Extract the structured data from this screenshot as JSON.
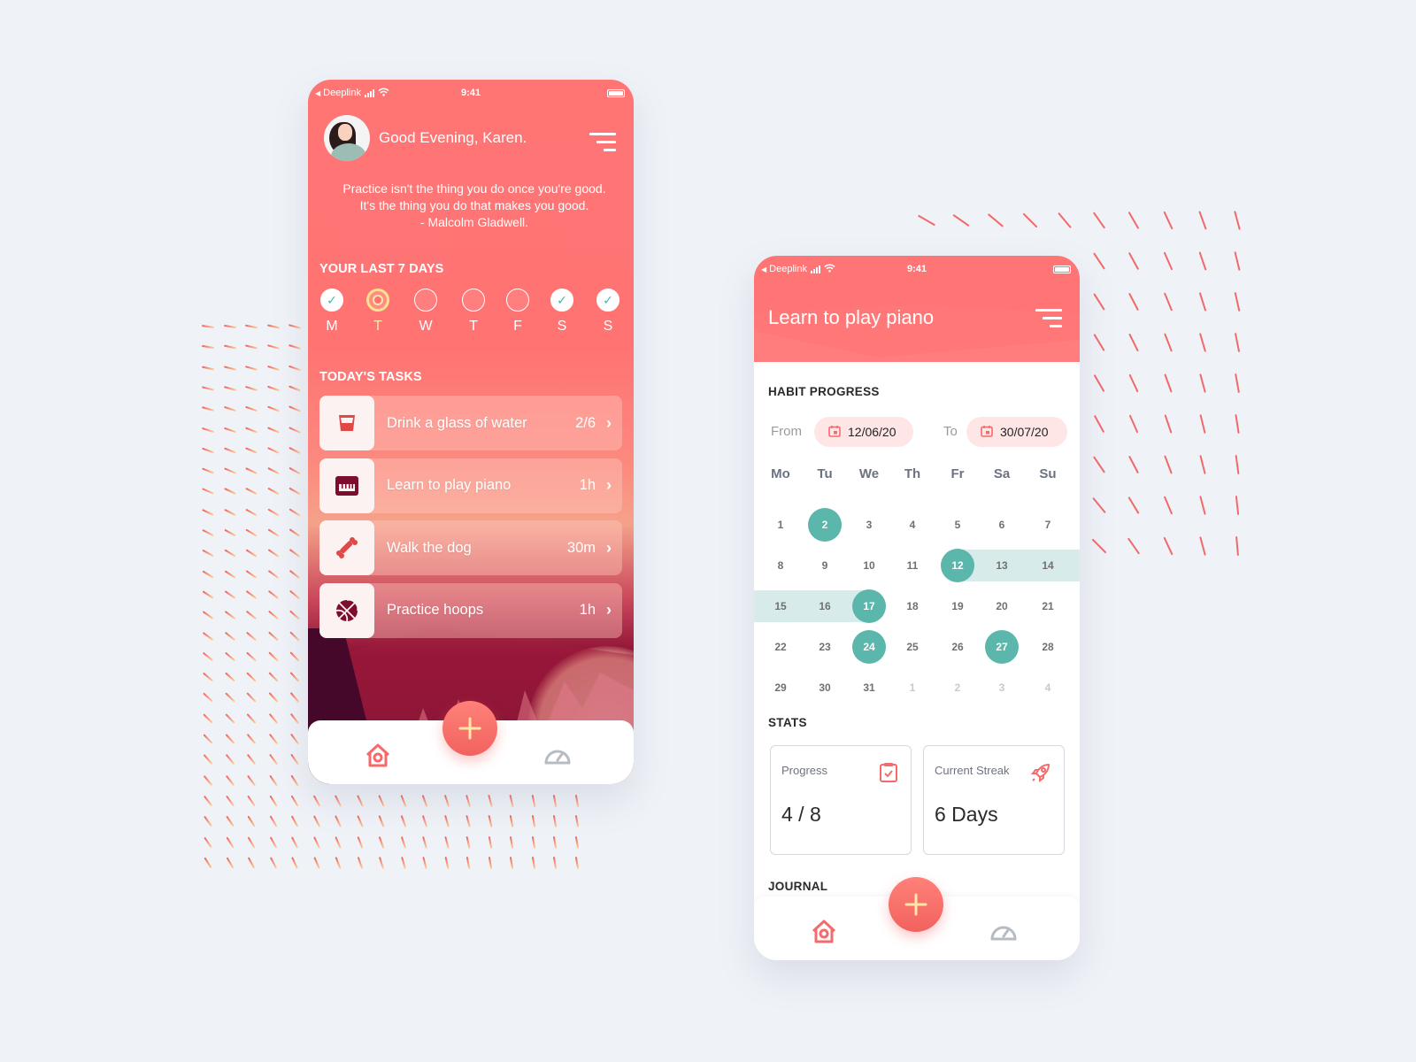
{
  "status_bar": {
    "back_label": "◀",
    "carrier": "Deeplink",
    "wifi_icon": "wifi-icon",
    "time": "9:41"
  },
  "home_screen": {
    "greeting": "Good Evening, Karen.",
    "avatar_icon": "avatar-karen",
    "menu_icon": "menu-icon",
    "quote_line1": "Practice isn't the thing you do once you're good.",
    "quote_line2": "It's the thing you do that makes you good.",
    "quote_line3": "- Malcolm Gladwell.",
    "last7_title": "YOUR LAST 7 DAYS",
    "days": [
      {
        "label": "M",
        "state": "done"
      },
      {
        "label": "T",
        "state": "current"
      },
      {
        "label": "W",
        "state": "empty"
      },
      {
        "label": "T",
        "state": "empty"
      },
      {
        "label": "F",
        "state": "empty"
      },
      {
        "label": "S",
        "state": "done"
      },
      {
        "label": "S",
        "state": "done"
      }
    ],
    "check_glyph": "✓",
    "tasks_title": "TODAY'S TASKS",
    "tasks": [
      {
        "name": "Drink a glass of water",
        "value": "2/6",
        "icon": "glass-icon"
      },
      {
        "name": "Learn to play piano",
        "value": "1h",
        "icon": "piano-icon"
      },
      {
        "name": "Walk the dog",
        "value": "30m",
        "icon": "bone-icon"
      },
      {
        "name": "Practice hoops",
        "value": "1h",
        "icon": "basketball-icon"
      }
    ],
    "chevron": "›"
  },
  "habit_screen": {
    "title": "Learn to play piano",
    "habit_progress_title": "HABIT PROGRESS",
    "from_label": "From",
    "from_date": "12/06/20",
    "to_label": "To",
    "to_date": "30/07/20",
    "weekdays": [
      "Mo",
      "Tu",
      "We",
      "Th",
      "Fr",
      "Sa",
      "Su"
    ],
    "calendar_weeks": [
      [
        "1",
        "2",
        "3",
        "4",
        "5",
        "6",
        "7"
      ],
      [
        "8",
        "9",
        "10",
        "11",
        "12",
        "13",
        "14"
      ],
      [
        "15",
        "16",
        "17",
        "18",
        "19",
        "20",
        "21"
      ],
      [
        "22",
        "23",
        "24",
        "25",
        "26",
        "27",
        "28"
      ],
      [
        "29",
        "30",
        "31",
        "1",
        "2",
        "3",
        "4"
      ]
    ],
    "selected_days": [
      "2",
      "12",
      "17",
      "24",
      "27"
    ],
    "streak_range": {
      "start": "12",
      "end": "17"
    },
    "stats_title": "STATS",
    "stats": [
      {
        "label": "Progress",
        "value": "4 / 8",
        "icon": "clipboard-check-icon"
      },
      {
        "label": "Current Streak",
        "value": "6 Days",
        "icon": "rocket-icon"
      }
    ],
    "journal_title": "JOURNAL"
  },
  "bottom_nav": {
    "home_icon": "home-icon",
    "add_icon": "plus-icon",
    "stats_icon": "gauge-icon"
  },
  "colors": {
    "primary": "#ff7474",
    "teal": "#5bb6ab",
    "teal_light": "#d7ecea",
    "pill_bg": "#ffe6e6",
    "background": "#eff2f7",
    "accent_yellow": "#fde7a8"
  }
}
